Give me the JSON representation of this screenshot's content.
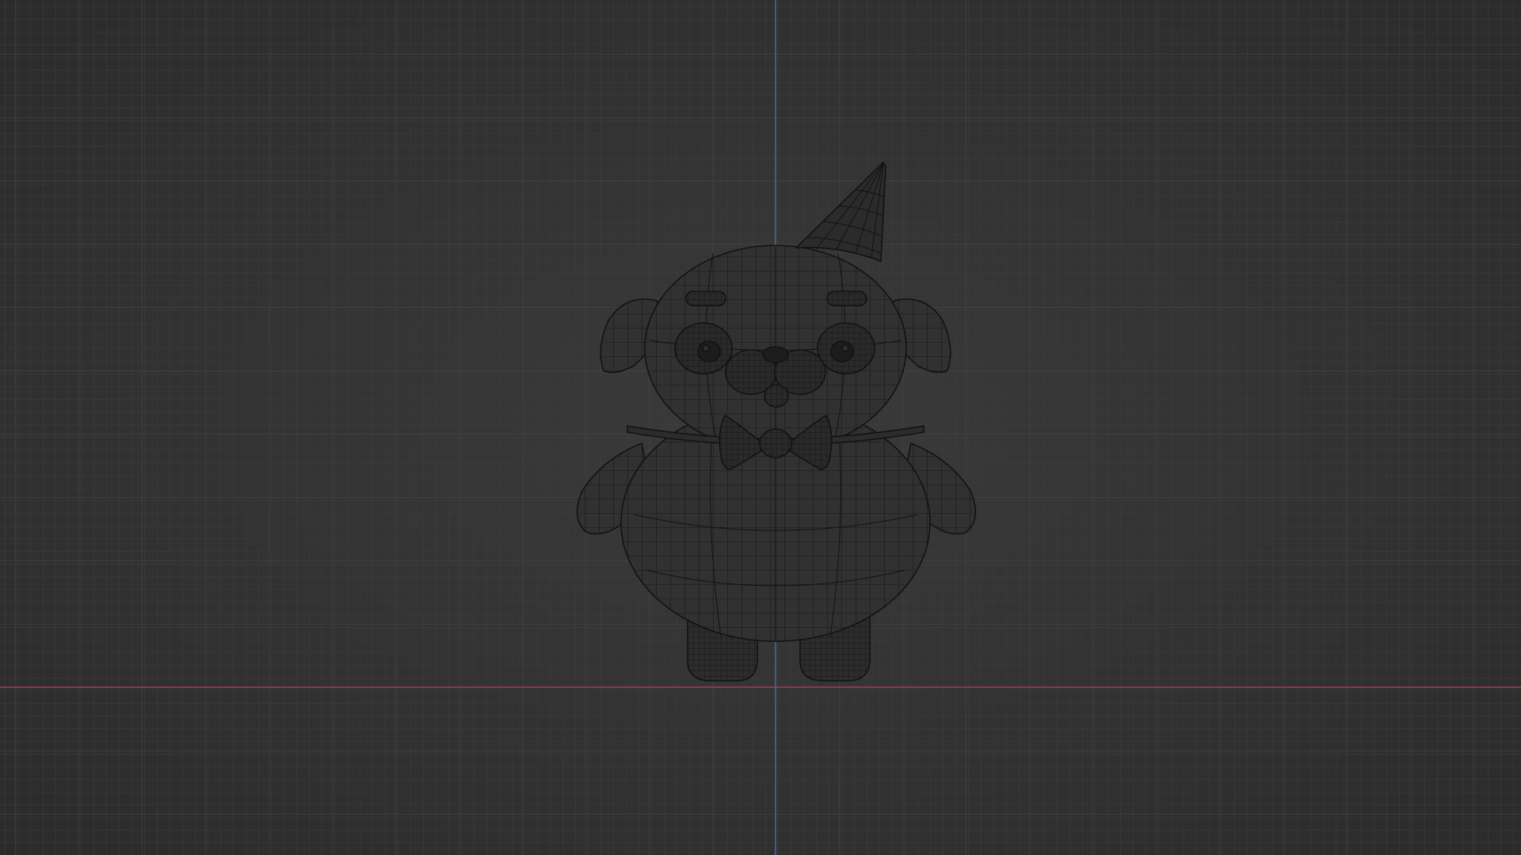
{
  "viewport": {
    "view": "front-orthographic",
    "shading": "wireframe",
    "colors": {
      "background": "#333333",
      "grid_minor": "#3d3d3d",
      "grid_major": "#474747",
      "x_axis": "#a0404c",
      "z_axis": "#3f6fa3",
      "wire": "#121212",
      "fill": "#2f2f2f"
    }
  },
  "model": {
    "name": "",
    "parts": [
      "party-hat",
      "head",
      "left-ear",
      "right-ear",
      "left-eye",
      "right-eye",
      "left-brow",
      "right-brow",
      "muzzle",
      "nose",
      "collar",
      "bow-tie",
      "body",
      "left-arm",
      "right-arm",
      "left-foot",
      "right-foot"
    ]
  }
}
